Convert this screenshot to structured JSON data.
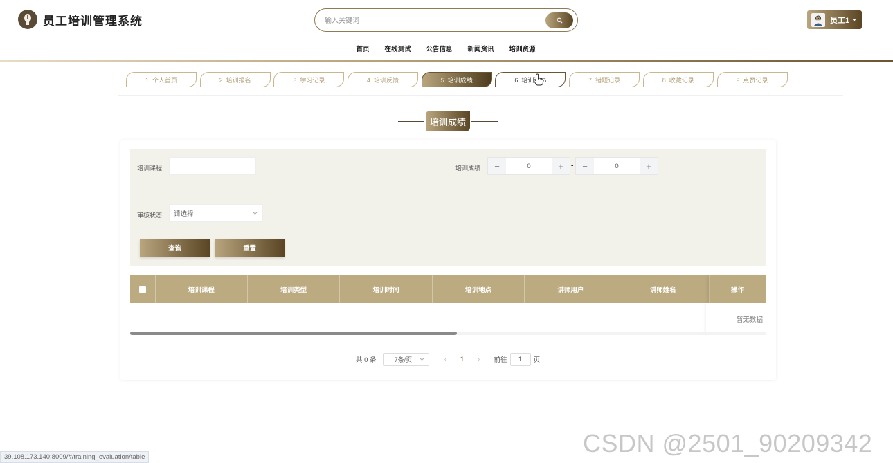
{
  "header": {
    "app_title": "员工培训管理系统",
    "search_placeholder": "输入关键词",
    "user_name": "员工1",
    "nav": [
      "首页",
      "在线测试",
      "公告信息",
      "新闻资讯",
      "培训资源"
    ]
  },
  "tabs": [
    {
      "label": "1. 个人首页",
      "state": "normal"
    },
    {
      "label": "2. 培训报名",
      "state": "normal"
    },
    {
      "label": "3. 学习记录",
      "state": "normal"
    },
    {
      "label": "4. 培训反馈",
      "state": "normal"
    },
    {
      "label": "5. 培训成绩",
      "state": "active"
    },
    {
      "label": "6. 培训证书",
      "state": "hover"
    },
    {
      "label": "7. 错题记录",
      "state": "normal"
    },
    {
      "label": "8. 收藏记录",
      "state": "normal"
    },
    {
      "label": "9. 点赞记录",
      "state": "normal"
    }
  ],
  "section_title": "培训成绩",
  "filter": {
    "course_label": "培训课程",
    "course_value": "",
    "score_label": "培训成绩",
    "score_min": "0",
    "score_max": "0",
    "range_separator": "-",
    "status_label": "审核状态",
    "status_placeholder": "请选择",
    "query_button": "查询",
    "reset_button": "重置"
  },
  "table": {
    "columns": [
      "培训课程",
      "培训类型",
      "培训时间",
      "培训地点",
      "讲师用户",
      "讲师姓名"
    ],
    "action_column": "操作",
    "empty_text": "暂无数据"
  },
  "pagination": {
    "total": "共 0 条",
    "page_size": "7条/页",
    "current_page": "1",
    "goto_label": "前往",
    "goto_value": "1",
    "page_suffix": "页"
  },
  "status_url": "39.108.173.140:8009/#/training_evaluation/table",
  "watermark": "CSDN @2501_90209342",
  "colors": {
    "accent_light": "#b9a57e",
    "accent_dark": "#5a4524",
    "filter_bg": "#f2f1ea",
    "table_header": "#bcaa80"
  }
}
